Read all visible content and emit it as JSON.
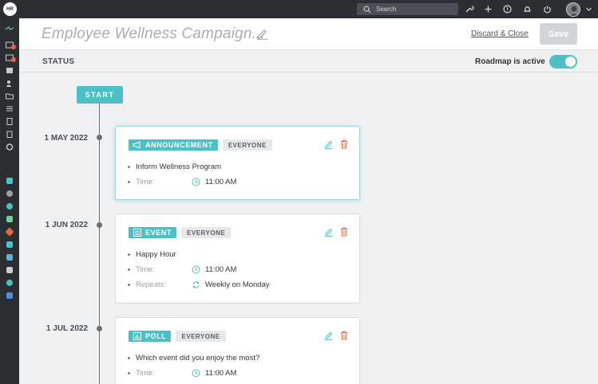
{
  "app": {
    "logo_text": "HR"
  },
  "topbar": {
    "search_placeholder": "Search",
    "icons": [
      "wrench-icon",
      "plus-icon",
      "help-icon",
      "bell-icon",
      "power-icon",
      "avatar",
      "chevron-down-icon"
    ]
  },
  "header": {
    "title": "Employee Wellness Campaign...",
    "discard_label": "Discard & Close",
    "save_label": "Save"
  },
  "status": {
    "label": "STATUS",
    "roadmap_label": "Roadmap is active",
    "roadmap_active": true
  },
  "timeline": {
    "start_label": "START",
    "items": [
      {
        "date": "1 MAY 2022",
        "type": "ANNOUNCEMENT",
        "icon": "megaphone-icon",
        "audience": "EVERYONE",
        "title": "Inform Wellness Program",
        "time_label": "Time:",
        "time": "11:00 AM",
        "active": true
      },
      {
        "date": "1 JUN 2022",
        "type": "EVENT",
        "icon": "calendar-icon",
        "audience": "EVERYONE",
        "title": "Happy Hour",
        "time_label": "Time:",
        "time": "11:00 AM",
        "repeats_label": "Repeats:",
        "repeats": "Weekly on Monday"
      },
      {
        "date": "1 JUL 2022",
        "type": "POLL",
        "icon": "poll-icon",
        "audience": "EVERYONE",
        "title": "Which event did you enjoy the most?",
        "time_label": "Time:",
        "time": "11:00 AM"
      }
    ]
  },
  "colors": {
    "accent": "#4cc0c4",
    "dark": "#2b2f33",
    "danger": "#e8643c"
  }
}
